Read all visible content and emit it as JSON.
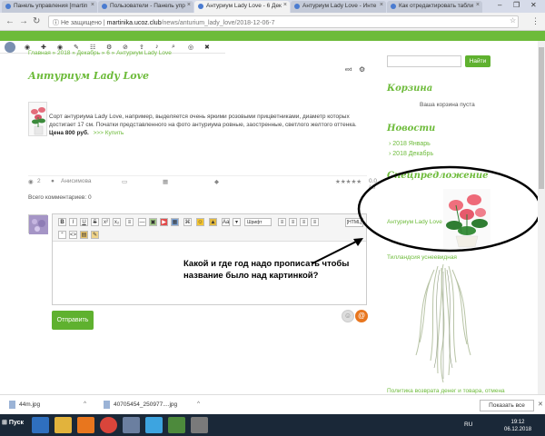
{
  "browser": {
    "tabs": [
      {
        "label": "Панель управления [martin"
      },
      {
        "label": "Пользователи - Панель упр"
      },
      {
        "label": "Антуриум Lady Love - 6 Дек"
      },
      {
        "label": "Антуриум Lady Love - Инте"
      },
      {
        "label": "Как отредактировать табли"
      }
    ],
    "active_tab": 2,
    "url_security": "Не защищено",
    "url_domain": "martinika.ucoz.club",
    "url_path": "/news/anturium_lady_love/2018-12-06-7"
  },
  "breadcrumb": "Главная » 2018 » Декабрь » 6 » Антуриум Lady Love",
  "article": {
    "title": "Антуриум Lady Love",
    "ext_link": "ext",
    "description": "Сорт антуриума Lady Love, например, выделяется очень яркими розовыми прицветниками, диаметр которых достигает 17 см. Початки представленного на фото антуриума ровные, заостренные, светлого желтого оттенка.",
    "price": "Цена 800 руб.",
    "buy_link": ">>> Купить",
    "views": "2",
    "author": "Анисимова",
    "rating": "0.0 / 0"
  },
  "comments": {
    "total": "Всего комментариев: 0",
    "font_select": "Шрифт",
    "html_button": "[HTML]",
    "submit": "Отправить"
  },
  "annotation": "Какой и где год надо прописать чтобы название было над картинкой?",
  "sidebar": {
    "search_button": "Найти",
    "cart_title": "Корзина",
    "cart_empty": "Ваша корзина пуста",
    "news_title": "Новости",
    "news": [
      {
        "label": "2018 Январь"
      },
      {
        "label": "2018 Декабрь"
      }
    ],
    "special_title": "Спецпредложение",
    "special_item": "Антуриум Lady Love",
    "special_item2": "Тилландсия уснеевидная",
    "policy": "Политика возврата денег и товара, отмена"
  },
  "downloads": [
    {
      "name": "44m.jpg"
    },
    {
      "name": "40705454_250977....jpg"
    }
  ],
  "downloads_show_all": "Показать все",
  "taskbar": {
    "start": "Пуск",
    "lang": "RU",
    "time": "19:12",
    "date": "06.12.2018"
  },
  "colors": {
    "accent": "#6dbb3a",
    "button": "#5fb12f",
    "orange": "#e8761e"
  }
}
